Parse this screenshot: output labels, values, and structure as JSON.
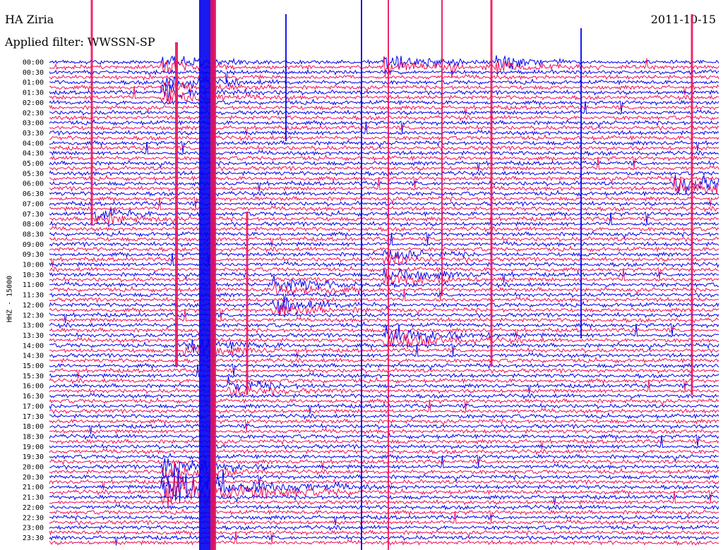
{
  "header": {
    "station": "HA Ziria",
    "date": "2011-10-15",
    "filter": "Applied filter: WWSSN-SP"
  },
  "chart_data": {
    "type": "line",
    "title": "HA Ziria",
    "subtitle": "Applied filter: WWSSN-SP",
    "date": "2011-10-15",
    "ylabel": "HHZ - 15000",
    "row_labels": [
      "00:00",
      "00:30",
      "01:00",
      "01:30",
      "02:00",
      "02:30",
      "03:00",
      "03:30",
      "04:00",
      "04:30",
      "05:00",
      "05:30",
      "06:00",
      "06:30",
      "07:00",
      "07:30",
      "08:00",
      "08:30",
      "09:00",
      "09:30",
      "10:00",
      "10:30",
      "11:00",
      "11:30",
      "12:00",
      "12:30",
      "13:00",
      "13:30",
      "14:00",
      "14:30",
      "15:00",
      "15:30",
      "16:00",
      "16:30",
      "17:00",
      "17:30",
      "18:00",
      "18:30",
      "19:00",
      "19:30",
      "20:00",
      "20:30",
      "21:00",
      "21:30",
      "22:00",
      "22:30",
      "23:00",
      "23:30"
    ],
    "colors": [
      "#0000ee",
      "#ee1155"
    ],
    "row_minutes": 15,
    "events": [
      {
        "time": "00:05",
        "amp": 1.6,
        "dur": 0.4
      },
      {
        "time": "00:15",
        "amp": 2.0,
        "dur": 0.5
      },
      {
        "time": "00:20",
        "amp": 1.4,
        "dur": 0.4
      },
      {
        "time": "01:05",
        "amp": 1.5,
        "dur": 0.5
      },
      {
        "time": "01:35",
        "amp": 1.6,
        "dur": 0.5
      },
      {
        "time": "06:28",
        "amp": 2.2,
        "dur": 0.6
      },
      {
        "time": "07:32",
        "amp": 1.5,
        "dur": 0.4
      },
      {
        "time": "09:45",
        "amp": 1.4,
        "dur": 0.4
      },
      {
        "time": "10:45",
        "amp": 1.6,
        "dur": 0.5
      },
      {
        "time": "11:10",
        "amp": 1.8,
        "dur": 0.5
      },
      {
        "time": "12:10",
        "amp": 1.5,
        "dur": 0.5
      },
      {
        "time": "13:45",
        "amp": 2.0,
        "dur": 0.6
      },
      {
        "time": "14:06",
        "amp": 1.6,
        "dur": 0.5
      },
      {
        "time": "16:08",
        "amp": 1.6,
        "dur": 0.4
      },
      {
        "time": "21:05",
        "amp": 5.0,
        "dur": 0.8
      },
      {
        "time": "20:05",
        "amp": 2.5,
        "dur": 0.5
      }
    ]
  }
}
